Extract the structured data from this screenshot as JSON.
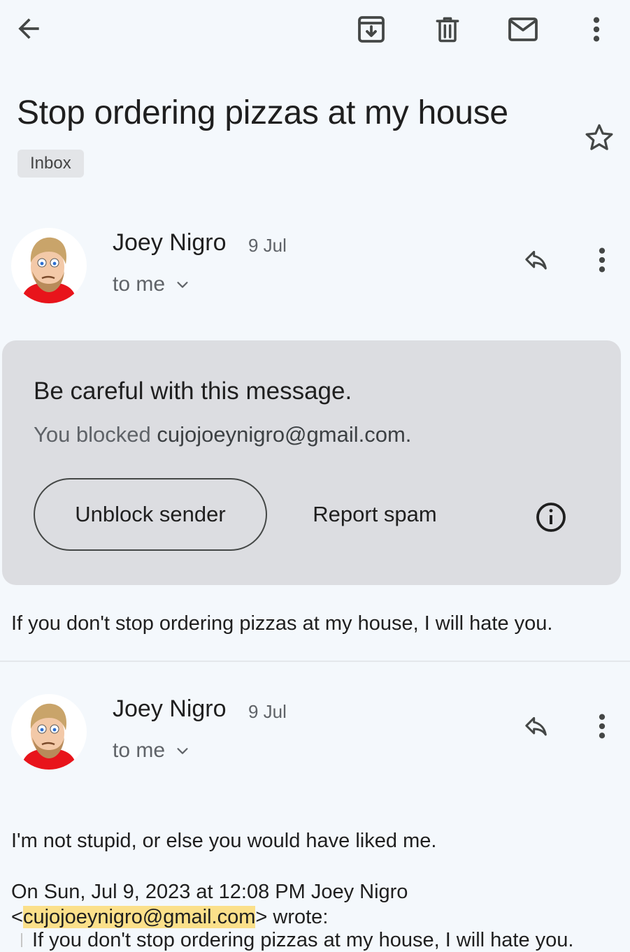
{
  "toolbar": {
    "back_icon": "arrow-back-icon",
    "archive_icon": "archive-icon",
    "delete_icon": "trash-icon",
    "mark_unread_icon": "mail-icon",
    "more_icon": "more-vert-icon"
  },
  "email": {
    "subject": "Stop ordering pizzas at my house",
    "label": "Inbox",
    "starred": false
  },
  "messages": [
    {
      "sender": "Joey Nigro",
      "date": "9 Jul",
      "recipient": "to me",
      "body": "If you don't stop ordering pizzas at my house, I will hate you."
    },
    {
      "sender": "Joey Nigro",
      "date": "9 Jul",
      "recipient": "to me",
      "body": "I'm not stupid, or else you would have liked me.",
      "quote_header_line1": "On Sun, Jul 9, 2023 at 12:08 PM Joey Nigro",
      "quote_header_lt": "<",
      "quote_email": "cujojoeynigro@gmail.com",
      "quote_header_gt": "> wrote:",
      "quoted_text": "If you don't stop ordering pizzas at my house, I will hate you."
    }
  ],
  "warning": {
    "title": "Be careful with this message.",
    "text_prefix": "You blocked ",
    "blocked_email": "cujojoeynigro@gmail.com.",
    "unblock_label": "Unblock sender",
    "report_label": "Report spam",
    "info_icon": "info-icon"
  },
  "colors": {
    "background": "#f4f8fc",
    "warning_card": "#dcdde1",
    "email_highlight": "#fbe08a",
    "avatar_shirt": "#e8141b"
  }
}
